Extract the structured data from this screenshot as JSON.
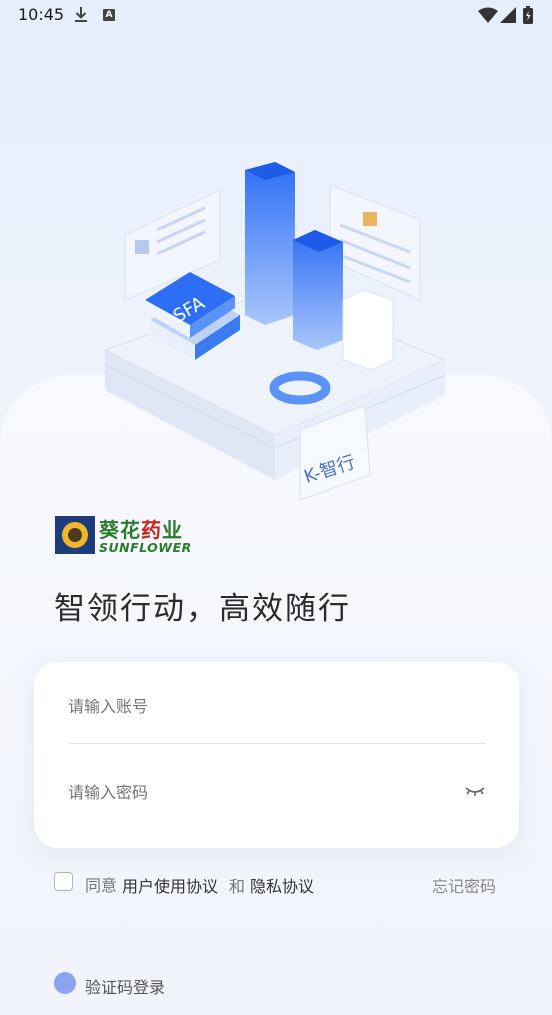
{
  "status_bar": {
    "time": "10:45",
    "icons": [
      "download-icon",
      "a-icon",
      "wifi-icon",
      "signal-icon",
      "battery-icon"
    ]
  },
  "hero": {
    "illustration_label_sfa": "SFA",
    "illustration_label_k": "K-智行"
  },
  "logo": {
    "cn_part1": "葵花",
    "cn_part2": "药",
    "cn_part3": "业",
    "en": "SUNFLOWER"
  },
  "slogan": "智领行动，高效随行",
  "form": {
    "account_placeholder": "请输入账号",
    "password_placeholder": "请输入密码"
  },
  "agreement": {
    "prefix": "同意",
    "user_agreement": "用户使用协议",
    "and": "和",
    "privacy_agreement": "隐私协议",
    "forgot_password": "忘记密码"
  },
  "code_login": {
    "label": "验证码登录"
  },
  "colors": {
    "background": "#e6eefb",
    "brand_green": "#2a7c2a",
    "brand_red": "#c8251f",
    "accent_blue": "#3a7bf0"
  }
}
